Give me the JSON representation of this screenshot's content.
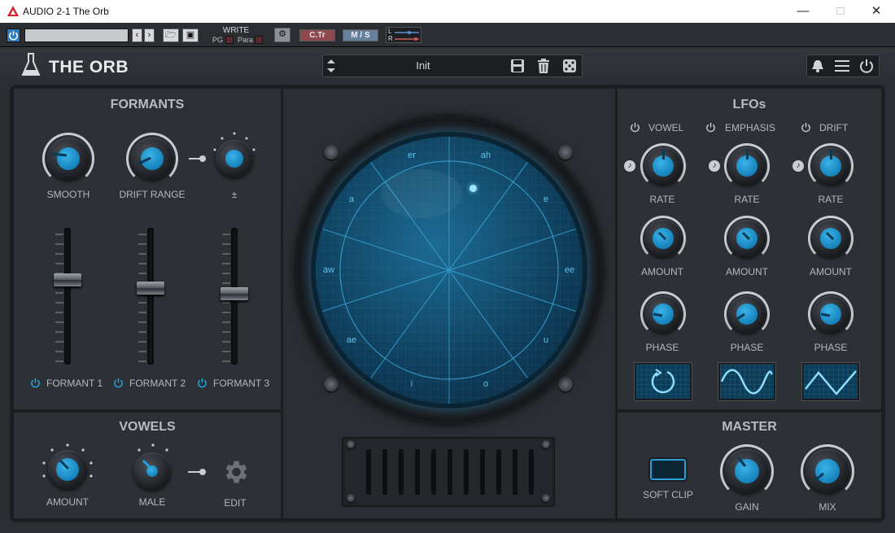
{
  "window": {
    "title": "AUDIO 2-1 The Orb"
  },
  "host": {
    "write_label": "WRITE",
    "pg_label": "PG",
    "para_label": "Para",
    "ctr_label": "C.Tr",
    "ms_label": "M / S",
    "l_label": "L",
    "r_label": "R"
  },
  "plugin": {
    "name": "THE ORB",
    "preset": "Init"
  },
  "formants": {
    "title": "FORMANTS",
    "smooth_label": "SMOOTH",
    "drift_range_label": "DRIFT RANGE",
    "plusminus_label": "±",
    "formant1_label": "FORMANT 1",
    "formant2_label": "FORMANT 2",
    "formant3_label": "FORMANT 3",
    "fader_levels": [
      0.62,
      0.56,
      0.52
    ]
  },
  "vowels": {
    "title": "VOWELS",
    "amount_label": "AMOUNT",
    "male_label": "MALE",
    "edit_label": "EDIT"
  },
  "orb": {
    "vowels": [
      "er",
      "ah",
      "e",
      "ee",
      "u",
      "o",
      "i",
      "ae",
      "aw",
      "a"
    ]
  },
  "lfos": {
    "title": "LFOs",
    "columns": [
      {
        "name": "VOWEL",
        "rate_label": "RATE",
        "amount_label": "AMOUNT",
        "phase_label": "PHASE",
        "shape": "cycle"
      },
      {
        "name": "EMPHASIS",
        "rate_label": "RATE",
        "amount_label": "AMOUNT",
        "phase_label": "PHASE",
        "shape": "sine"
      },
      {
        "name": "DRIFT",
        "rate_label": "RATE",
        "amount_label": "AMOUNT",
        "phase_label": "PHASE",
        "shape": "triangle"
      }
    ]
  },
  "master": {
    "title": "MASTER",
    "soft_clip_label": "SOFT CLIP",
    "gain_label": "GAIN",
    "mix_label": "MIX"
  },
  "colors": {
    "accent": "#1e9ad6",
    "panel": "#2d3035",
    "background": "#1a1c20"
  },
  "icons": [
    "bell-icon",
    "menu-icon",
    "power-icon",
    "save-icon",
    "trash-icon",
    "dice-icon",
    "gear-icon",
    "flask-icon",
    "note-icon"
  ]
}
